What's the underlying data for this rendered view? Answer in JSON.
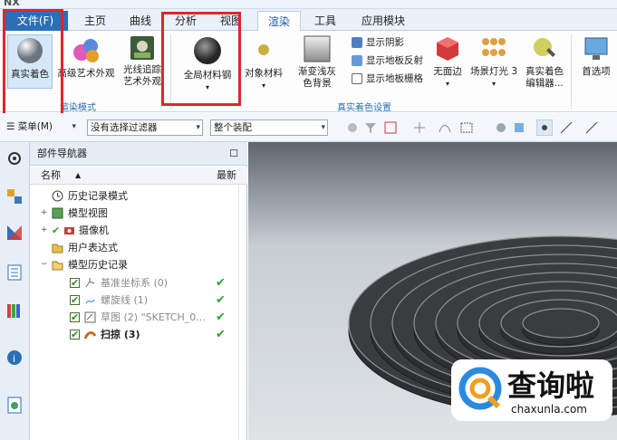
{
  "window": {
    "app_abbrev": "NX"
  },
  "menu": {
    "file": "文件(F)",
    "tabs": [
      "主页",
      "曲线",
      "分析",
      "视图",
      "渲染",
      "工具",
      "应用模块"
    ],
    "active_tab": "渲染"
  },
  "ribbon": {
    "buttons": {
      "true_shading": "真实着色",
      "advanced_art": "高级艺术外观",
      "ray_trace_line1": "光线追踪",
      "ray_trace_line2": "艺术外观",
      "global_material": "全局材料钢",
      "object_material": "对象材料",
      "gradient_bg_line1": "渐变浅灰",
      "gradient_bg_line2": "色背景",
      "no_edge": "无面边",
      "scene_light": "场景灯光 3",
      "editor_line1": "真实着色",
      "editor_line2": "编辑器...",
      "preferences": "首选项"
    },
    "small_items": [
      "显示阴影",
      "显示地板反射",
      "显示地板栅格"
    ],
    "groups": [
      "渲染模式",
      "真实着色设置"
    ]
  },
  "toolbar": {
    "menu_label": "菜单(M)",
    "filter_value": "没有选择过滤器",
    "assembly_value": "整个装配"
  },
  "navigator": {
    "title": "部件导航器",
    "col_name": "名称",
    "col_latest": "最新",
    "rows": [
      {
        "label": "历史记录模式"
      },
      {
        "label": "模型视图"
      },
      {
        "label": "摄像机"
      },
      {
        "label": "用户表达式"
      },
      {
        "label": "模型历史记录"
      },
      {
        "label": "基准坐标系 (0)"
      },
      {
        "label": "螺旋线 (1)"
      },
      {
        "label": "草图 (2) \"SKETCH_0..."
      },
      {
        "label": "扫掠 (3)"
      }
    ]
  },
  "watermark": {
    "brand": "查询啦",
    "url": "chaxunla.com"
  },
  "colors": {
    "highlight_box": "#e0262c",
    "accent": "#2b6fb6"
  }
}
